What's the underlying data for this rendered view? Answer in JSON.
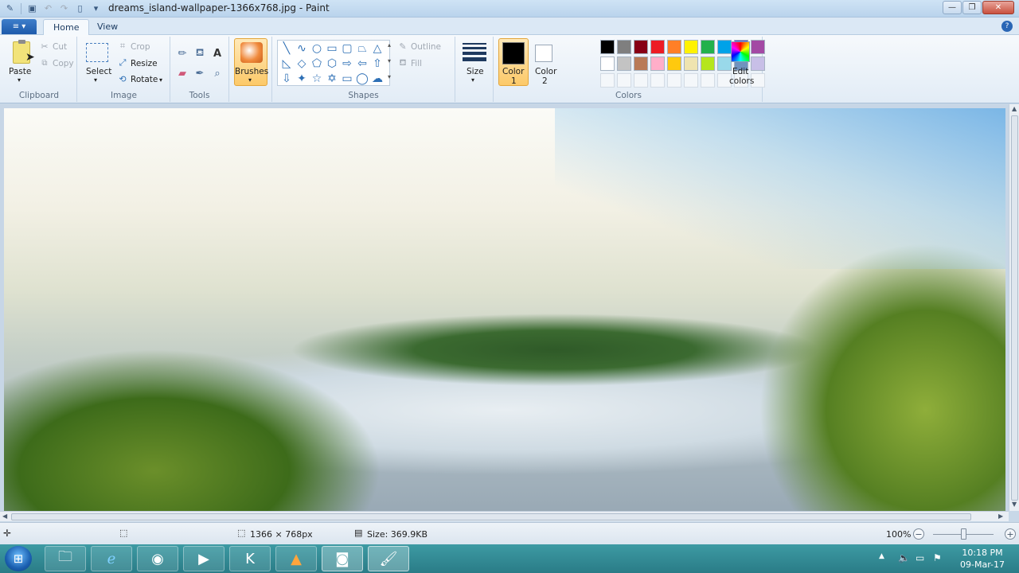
{
  "window": {
    "title": "dreams_island-wallpaper-1366x768.jpg - Paint"
  },
  "tabs": {
    "home": "Home",
    "view": "View"
  },
  "clipboard": {
    "paste": "Paste",
    "cut": "Cut",
    "copy": "Copy",
    "group_label": "Clipboard"
  },
  "image": {
    "select": "Select",
    "crop": "Crop",
    "resize": "Resize",
    "rotate": "Rotate",
    "group_label": "Image"
  },
  "tools": {
    "group_label": "Tools"
  },
  "brushes": {
    "label": "Brushes"
  },
  "shapes": {
    "outline": "Outline",
    "fill": "Fill",
    "group_label": "Shapes"
  },
  "size": {
    "label": "Size"
  },
  "colors": {
    "color1_line1": "Color",
    "color1_line2": "1",
    "color2_line1": "Color",
    "color2_line2": "2",
    "edit_line1": "Edit",
    "edit_line2": "colors",
    "group_label": "Colors",
    "palette_row1": [
      "#000000",
      "#7f7f7f",
      "#880015",
      "#ed1c24",
      "#ff7f27",
      "#fff200",
      "#22b14c",
      "#00a2e8",
      "#3f48cc",
      "#a349a4"
    ],
    "palette_row2": [
      "#ffffff",
      "#c3c3c3",
      "#b97a57",
      "#ffaec9",
      "#ffc90e",
      "#efe4b0",
      "#b5e61d",
      "#99d9ea",
      "#7092be",
      "#c8bfe7"
    ]
  },
  "status": {
    "dimensions": "1366 × 768px",
    "size": "Size: 369.9KB",
    "zoom": "100%"
  },
  "taskbar": {
    "time": "10:18 PM",
    "date": "09-Mar-17"
  }
}
